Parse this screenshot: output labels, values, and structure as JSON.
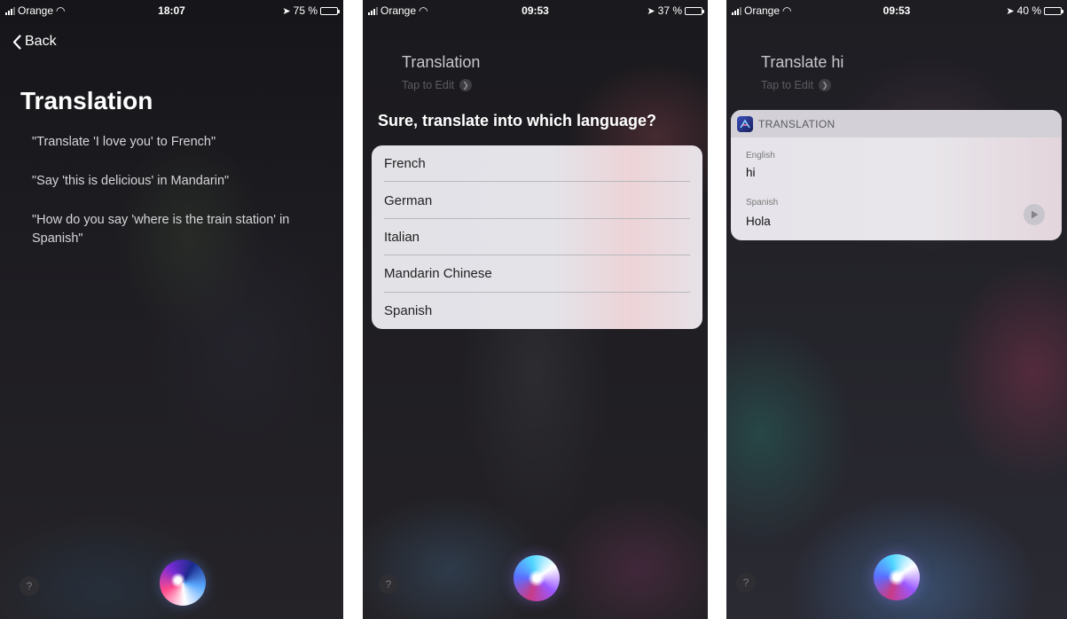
{
  "screens": [
    {
      "status": {
        "carrier": "Orange",
        "time": "18:07",
        "battery": "75 %",
        "battery_level": 0.75,
        "battery_color": "#ffffff"
      },
      "back_label": "Back",
      "title": "Translation",
      "examples": [
        "\"Translate 'I love you' to French\"",
        "\"Say 'this is delicious' in Mandarin\"",
        "\"How do you say 'where is the train station' in Spanish\""
      ],
      "help_label": "?"
    },
    {
      "status": {
        "carrier": "Orange",
        "time": "09:53",
        "battery": "37 %",
        "battery_level": 0.37,
        "battery_color": "#ffcc00"
      },
      "query": "Translation",
      "tap_to_edit": "Tap to Edit",
      "question": "Sure, translate into which language?",
      "languages": [
        "French",
        "German",
        "Italian",
        "Mandarin Chinese",
        "Spanish"
      ],
      "help_label": "?"
    },
    {
      "status": {
        "carrier": "Orange",
        "time": "09:53",
        "battery": "40 %",
        "battery_level": 0.4,
        "battery_color": "#ffcc00"
      },
      "query": "Translate hi",
      "tap_to_edit": "Tap to Edit",
      "card": {
        "header": "TRANSLATION",
        "source_language": "English",
        "source_text": "hi",
        "target_language": "Spanish",
        "target_text": "Hola"
      },
      "help_label": "?"
    }
  ]
}
